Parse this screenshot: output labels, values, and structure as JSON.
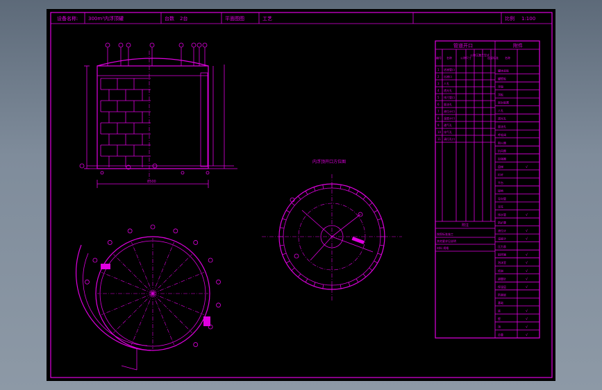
{
  "title_block": {
    "label_equipment": "设备名称:",
    "equipment_name": "300m³内浮顶罐",
    "label_quantity": "台数",
    "quantity": "2台",
    "label_drawing": "平面图图",
    "label_process": "工艺",
    "label_scale": "比例",
    "scale": "1:100"
  },
  "nozzle_table": {
    "title": "管道开口",
    "col_no": "编号",
    "col_name": "名称",
    "col_size": "公称尺寸",
    "col_rating": "公称压力",
    "col_face": "法兰型式",
    "col_std": "连接标准",
    "rows": [
      {
        "no": "1",
        "name": "进液管口"
      },
      {
        "no": "2",
        "name": "出液口"
      },
      {
        "no": "3",
        "name": "人孔"
      },
      {
        "no": "4",
        "name": "透光孔"
      },
      {
        "no": "5",
        "name": "排污管口"
      },
      {
        "no": "6",
        "name": "量油孔"
      },
      {
        "no": "7",
        "name": "液位计口"
      },
      {
        "no": "8",
        "name": "温度计口"
      },
      {
        "no": "9",
        "name": "通气孔"
      },
      {
        "no": "10",
        "name": "排气孔"
      },
      {
        "no": "11",
        "name": "清扫孔口"
      }
    ],
    "notes_title": "附注",
    "note_lines": [
      "按照标准施工",
      "其他要求见说明",
      "材料    规格"
    ]
  },
  "parts_table": {
    "title": "附件",
    "col_name": "名称",
    "rows": [
      {
        "name": "罐体底板",
        "mark": ""
      },
      {
        "name": "罐壁板",
        "mark": ""
      },
      {
        "name": "浮盘",
        "mark": ""
      },
      {
        "name": "顶板",
        "mark": ""
      },
      {
        "name": "密封装置",
        "mark": ""
      },
      {
        "name": "人孔",
        "mark": ""
      },
      {
        "name": "透光孔",
        "mark": ""
      },
      {
        "name": "量油孔",
        "mark": ""
      },
      {
        "name": "呼吸阀",
        "mark": ""
      },
      {
        "name": "阻火器",
        "mark": ""
      },
      {
        "name": "抗风圈",
        "mark": ""
      },
      {
        "name": "加强圈",
        "mark": ""
      },
      {
        "name": "盘梯",
        "mark": "√"
      },
      {
        "name": "栏杆",
        "mark": ""
      },
      {
        "name": "平台",
        "mark": ""
      },
      {
        "name": "接地",
        "mark": ""
      },
      {
        "name": "导向管",
        "mark": ""
      },
      {
        "name": "支柱",
        "mark": ""
      },
      {
        "name": "排水管",
        "mark": "√"
      },
      {
        "name": "防护罩",
        "mark": ""
      },
      {
        "name": "液位计",
        "mark": "√"
      },
      {
        "name": "温度计",
        "mark": "√"
      },
      {
        "name": "压力表",
        "mark": ""
      },
      {
        "name": "取样器",
        "mark": "√"
      },
      {
        "name": "泡沫室",
        "mark": "√"
      },
      {
        "name": "喷淋",
        "mark": "√"
      },
      {
        "name": "避雷针",
        "mark": "√"
      },
      {
        "name": "保温层",
        "mark": "√"
      },
      {
        "name": "防腐层",
        "mark": ""
      },
      {
        "name": "基础",
        "mark": ""
      },
      {
        "name": "底",
        "mark": "√"
      },
      {
        "name": "壁",
        "mark": "√"
      },
      {
        "name": "顶",
        "mark": "√"
      },
      {
        "name": "总重",
        "mark": "√"
      }
    ]
  },
  "plan_title": "内浮顶开口方位图",
  "elevation": {
    "dim_diameter": "8500"
  }
}
